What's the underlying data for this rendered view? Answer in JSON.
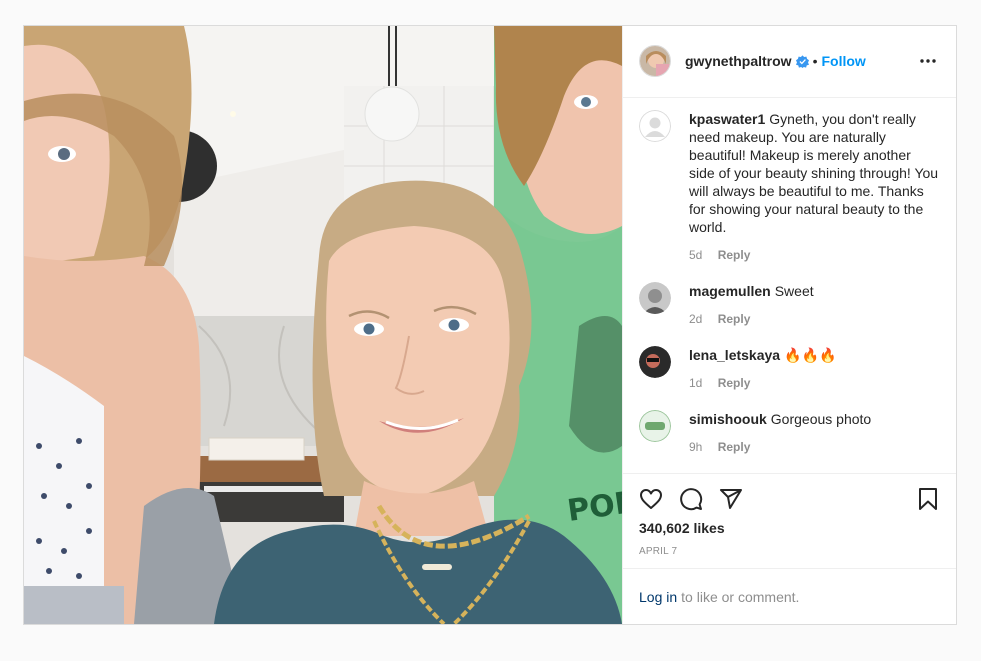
{
  "post": {
    "author": "gwynethpaltrow",
    "follow_label": "Follow",
    "dot": "•",
    "likes": "340,602 likes",
    "date": "APRIL 7"
  },
  "comments": [
    {
      "user": "kpaswater1",
      "text": "Gyneth, you don't really need makeup. You are naturally beautiful! Makeup is merely another side of your beauty shining through! You will always be beautiful to me. Thanks for showing your natural beauty to the world.",
      "age": "5d",
      "reply": "Reply"
    },
    {
      "user": "magemullen",
      "text": "Sweet",
      "age": "2d",
      "reply": "Reply"
    },
    {
      "user": "lena_letskaya",
      "text": "🔥🔥🔥",
      "age": "1d",
      "reply": "Reply"
    },
    {
      "user": "simishoouk",
      "text": "Gorgeous photo",
      "age": "9h",
      "reply": "Reply"
    }
  ],
  "login_bar": {
    "login_label": "Log in",
    "rest": "to like or comment."
  },
  "colors": {
    "accent": "#0095f6",
    "verified": "#3897f0",
    "text": "#262626",
    "muted": "#8e8e8e",
    "link_dark": "#00376b"
  },
  "icons": [
    "heart-icon",
    "comment-icon",
    "share-icon",
    "bookmark-icon",
    "more-options-icon",
    "verified-badge-icon"
  ]
}
